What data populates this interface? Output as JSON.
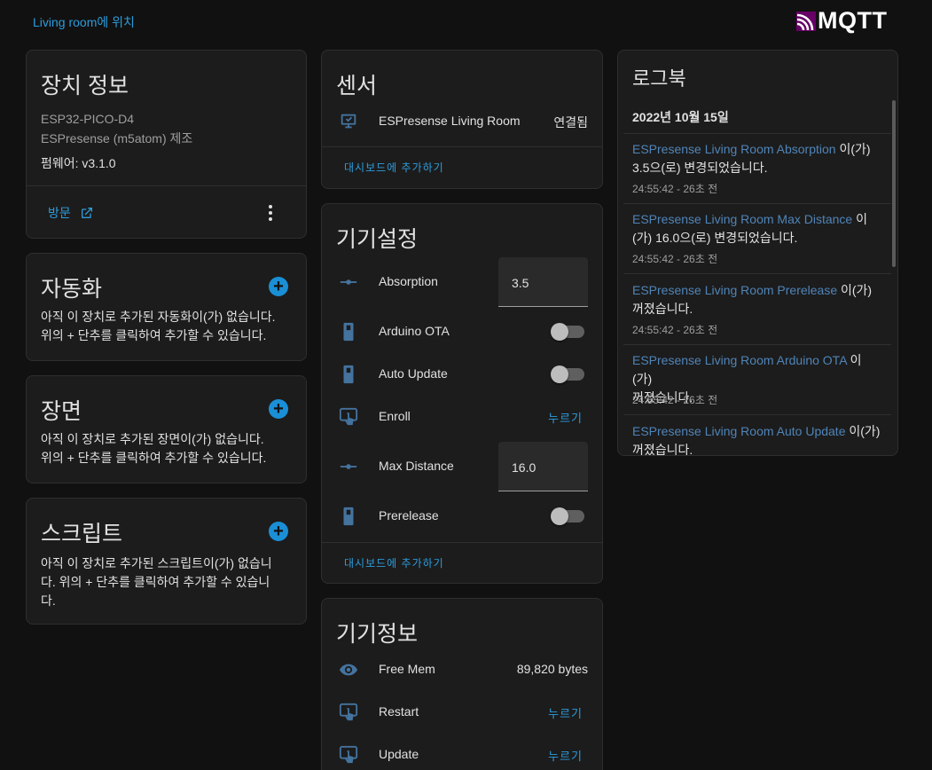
{
  "header": {
    "area_link": "Living room에 위치",
    "brand": "MQTT"
  },
  "device_info": {
    "title": "장치 정보",
    "model": "ESP32-PICO-D4",
    "manufacturer": "ESPresense (m5atom) 제조",
    "firmware": "펌웨어: v3.1.0",
    "visit_label": "방문"
  },
  "automation": {
    "title": "자동화",
    "empty_line1": "아직 이 장치로 추가된 자동화이(가) 없습니다.",
    "empty_line2": "위의 + 단추를 클릭하여 추가할 수 있습니다."
  },
  "scenes": {
    "title": "장면",
    "empty_line1": "아직 이 장치로 추가된 장면이(가) 없습니다.",
    "empty_line2": "위의 + 단추를 클릭하여 추가할 수 있습니다."
  },
  "scripts": {
    "title": "스크립트",
    "empty_line1": "아직 이 장치로 추가된 스크립트이(가) 없습니",
    "empty_line2": "다. 위의 + 단추를 클릭하여 추가할 수 있습니",
    "empty_line3": "다."
  },
  "sensors": {
    "title": "센서",
    "rows": [
      {
        "name": "ESPresense Living Room",
        "state": "연결됨",
        "icon": "monitor-check-icon"
      }
    ],
    "add_to_dashboard": "대시보드에 추가하기"
  },
  "config": {
    "title": "기기설정",
    "rows": [
      {
        "name": "Absorption",
        "type": "number",
        "value": "3.5",
        "icon": "slider-icon"
      },
      {
        "name": "Arduino OTA",
        "type": "switch",
        "on": false,
        "icon": "switch-icon"
      },
      {
        "name": "Auto Update",
        "type": "switch",
        "on": false,
        "icon": "switch-icon"
      },
      {
        "name": "Enroll",
        "type": "button",
        "action": "누르기",
        "icon": "gesture-tap-icon"
      },
      {
        "name": "Max Distance",
        "type": "number",
        "value": "16.0",
        "icon": "slider-icon"
      },
      {
        "name": "Prerelease",
        "type": "switch",
        "on": false,
        "icon": "switch-icon"
      }
    ],
    "add_to_dashboard": "대시보드에 추가하기"
  },
  "diagnostic": {
    "title": "기기정보",
    "rows": [
      {
        "name": "Free Mem",
        "state": "89,820 bytes",
        "icon": "eye-icon"
      },
      {
        "name": "Restart",
        "action": "누르기",
        "icon": "gesture-tap-icon"
      },
      {
        "name": "Update",
        "action": "누르기",
        "icon": "gesture-tap-icon"
      }
    ]
  },
  "logbook": {
    "title": "로그북",
    "date": "2022년 10월 15일",
    "entries": [
      {
        "entity": "ESPresense Living Room Absorption",
        "msg1": " 이(가)",
        "msg2": "3.5으(로) 변경되었습니다.",
        "time": "24:55:42 - 26초 전"
      },
      {
        "entity": "ESPresense Living Room Max Distance",
        "msg1": " 이",
        "msg2": "(가) 16.0으(로) 변경되었습니다.",
        "time": "24:55:42 - 26초 전"
      },
      {
        "entity": "ESPresense Living Room Prerelease",
        "msg1": " 이(가)",
        "msg2": "꺼졌습니다.",
        "time": "24:55:42 - 26초 전"
      },
      {
        "entity": "ESPresense Living Room Arduino OTA",
        "msg1": " 이(가)",
        "msg2": "꺼졌습니다.",
        "time": "24:55:42 - 26초 전"
      },
      {
        "entity": "ESPresense Living Room Auto Update",
        "msg1": " 이(가)",
        "msg2": "꺼졌습니다.",
        "time": ""
      }
    ]
  },
  "colors": {
    "background": "#111111",
    "card": "#1c1c1c",
    "accent": "#2d9cdb",
    "add_button": "#1a8fd6",
    "icon": "#44739e",
    "mqtt_purple": "#660066"
  }
}
